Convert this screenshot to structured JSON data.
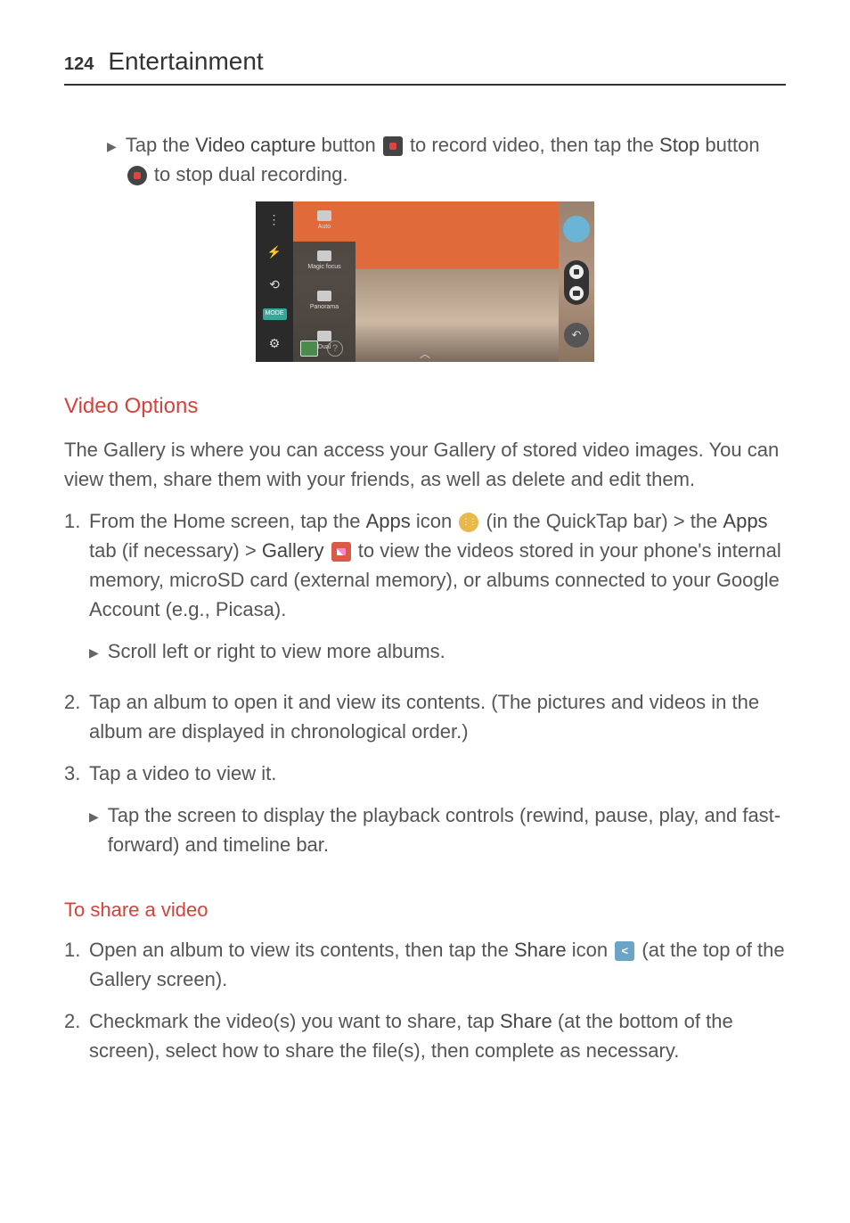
{
  "page": {
    "number": "124",
    "section": "Entertainment"
  },
  "intro": {
    "pre": "Tap the ",
    "b1": "Video capture",
    "mid1": " button ",
    "mid2": " to record video, then tap the ",
    "b2": "Stop",
    "mid3": " button ",
    "end": " to stop dual recording."
  },
  "screenshot": {
    "panel": {
      "auto": "Auto",
      "magic": "Magic focus",
      "pano": "Panorama",
      "dual": "Dual"
    },
    "mode": "MODE"
  },
  "video_options": {
    "heading": "Video Options",
    "para": "The Gallery is where you can access your Gallery of stored video images. You can view them, share them with your friends, as well as delete and edit them.",
    "step1": {
      "pre": "From the Home screen, tap the ",
      "b1": "Apps",
      "mid1": " icon ",
      "mid2": " (in the QuickTap bar) > the ",
      "b2": "Apps",
      "mid3": " tab (if necessary) > ",
      "b3": "Gallery",
      "mid4": " ",
      "end": " to view the videos stored in your phone's internal memory, microSD card (external memory), or albums connected to your Google Account (e.g., Picasa)."
    },
    "step1_bullet": "Scroll left or right to view more albums.",
    "step2": "Tap an album to open it and view its contents. (The pictures and videos in the album are displayed in chronological order.)",
    "step3": "Tap a video to view it.",
    "step3_bullet": "Tap the screen to display the playback controls (rewind, pause, play, and fast-forward) and timeline bar."
  },
  "share": {
    "heading": "To share a video",
    "step1": {
      "pre": "Open an album to view its contents, then tap the ",
      "b1": "Share",
      "mid1": " icon ",
      "end": " (at the top of the Gallery screen)."
    },
    "step2": {
      "pre": "Checkmark the video(s) you want to share, tap ",
      "b1": "Share",
      "end": " (at the bottom of the screen), select how to share the file(s), then complete as necessary."
    }
  }
}
